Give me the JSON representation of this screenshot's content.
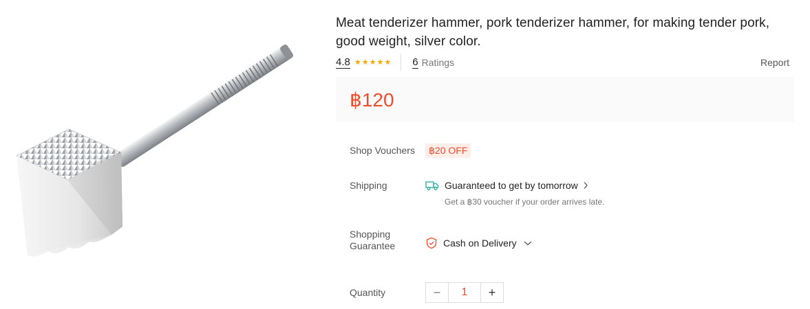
{
  "product": {
    "title": "Meat tenderizer hammer, pork tenderizer hammer, for making tender pork, good weight, silver color.",
    "image_icon": "meat-tenderizer-product-image"
  },
  "rating": {
    "score": "4.8",
    "stars": 5,
    "count": "6",
    "count_label": "Ratings",
    "report_label": "Report"
  },
  "price": {
    "value": "฿120"
  },
  "vouchers": {
    "label": "Shop Vouchers",
    "tag": "฿20 OFF"
  },
  "shipping": {
    "label": "Shipping",
    "headline": "Guaranteed to get by tomorrow",
    "subtext": "Get a ฿30 voucher if your order arrives late.",
    "icon": "truck-icon"
  },
  "guarantee": {
    "label_line1": "Shopping",
    "label_line2": "Guarantee",
    "value": "Cash on Delivery",
    "icon": "shield-icon"
  },
  "quantity": {
    "label": "Quantity",
    "value": "1",
    "minus": "−",
    "plus": "+"
  },
  "colors": {
    "accent": "#ee4d2d",
    "star": "#f6a700",
    "shipping_icon": "#26aa99"
  }
}
